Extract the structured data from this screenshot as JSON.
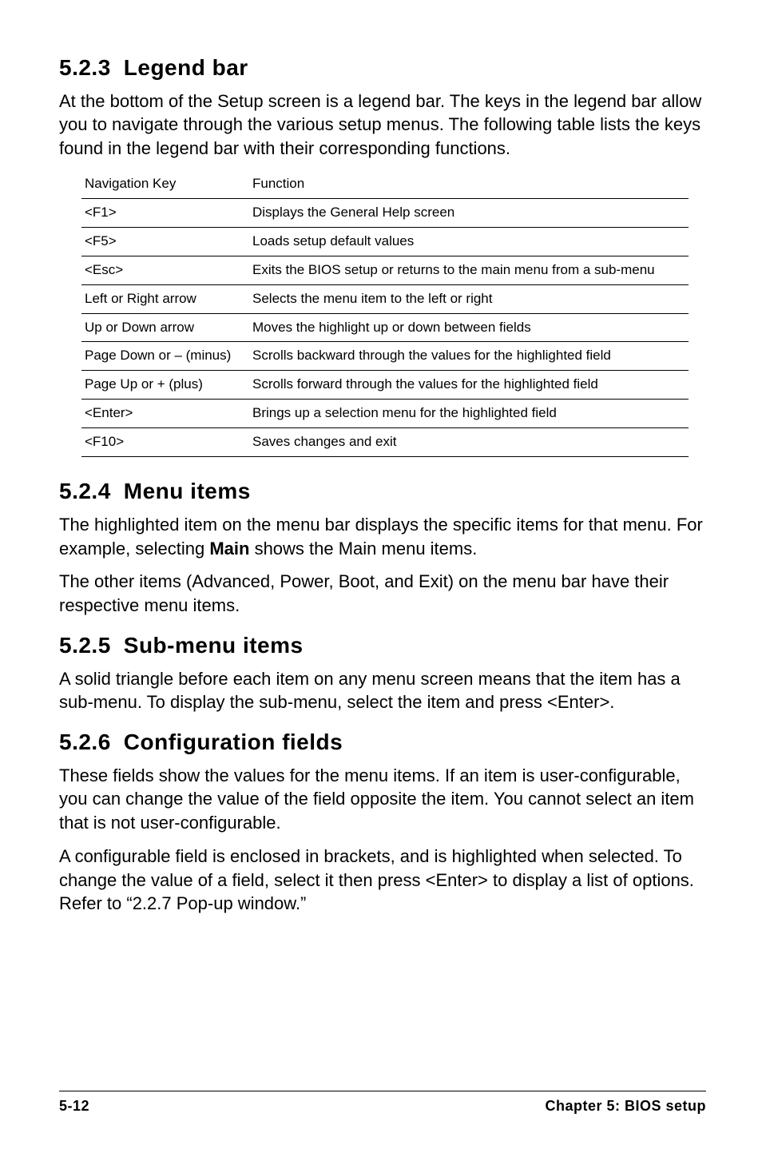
{
  "sections": {
    "s523": {
      "num": "5.2.3",
      "title": "Legend bar",
      "para": "At the bottom of the Setup screen is a legend bar. The keys in the legend bar allow you to navigate through the various setup menus. The following table lists the keys found in the legend bar with their corresponding functions."
    },
    "table": {
      "head_key": "Navigation Key",
      "head_func": "Function",
      "rows": [
        {
          "key": "<F1>",
          "func": "Displays the General Help screen"
        },
        {
          "key": "<F5>",
          "func": "Loads setup default values"
        },
        {
          "key": "<Esc>",
          "func": "Exits the BIOS setup or returns to the main menu from a sub-menu"
        },
        {
          "key": "Left or Right arrow",
          "func": "Selects the menu item to the left or right"
        },
        {
          "key": "Up or Down arrow",
          "func": "Moves the highlight up or down between fields"
        },
        {
          "key": "Page Down or – (minus)",
          "func": "Scrolls backward through the values for the highlighted field"
        },
        {
          "key": "Page Up or + (plus)",
          "func": "Scrolls forward through the values for the highlighted field"
        },
        {
          "key": "<Enter>",
          "func": "Brings up a selection menu for the highlighted field"
        },
        {
          "key": "<F10>",
          "func": "Saves changes and exit"
        }
      ]
    },
    "s524": {
      "num": "5.2.4",
      "title": "Menu items",
      "p1a": "The highlighted item on the menu bar  displays the specific items for that menu. For example, selecting ",
      "p1b": "Main",
      "p1c": " shows the Main menu items.",
      "p2": "The other items (Advanced, Power, Boot, and Exit) on the menu bar have their respective menu items."
    },
    "s525": {
      "num": "5.2.5",
      "title": "Sub-menu items",
      "p1": "A solid triangle before each item on any menu screen means that the item has a sub-menu. To display the sub-menu, select the item and press <Enter>."
    },
    "s526": {
      "num": "5.2.6",
      "title": "Configuration fields",
      "p1": "These fields show the values for the menu items. If an item is user-configurable, you can change the value of the field opposite the item. You cannot select an item that is not user-configurable.",
      "p2": "A configurable field is enclosed in brackets, and is highlighted when selected. To change the value of a field, select it then press <Enter> to display a list of options. Refer to “2.2.7 Pop-up window.”"
    }
  },
  "footer": {
    "page": "5-12",
    "chapter": "Chapter 5: BIOS setup"
  }
}
